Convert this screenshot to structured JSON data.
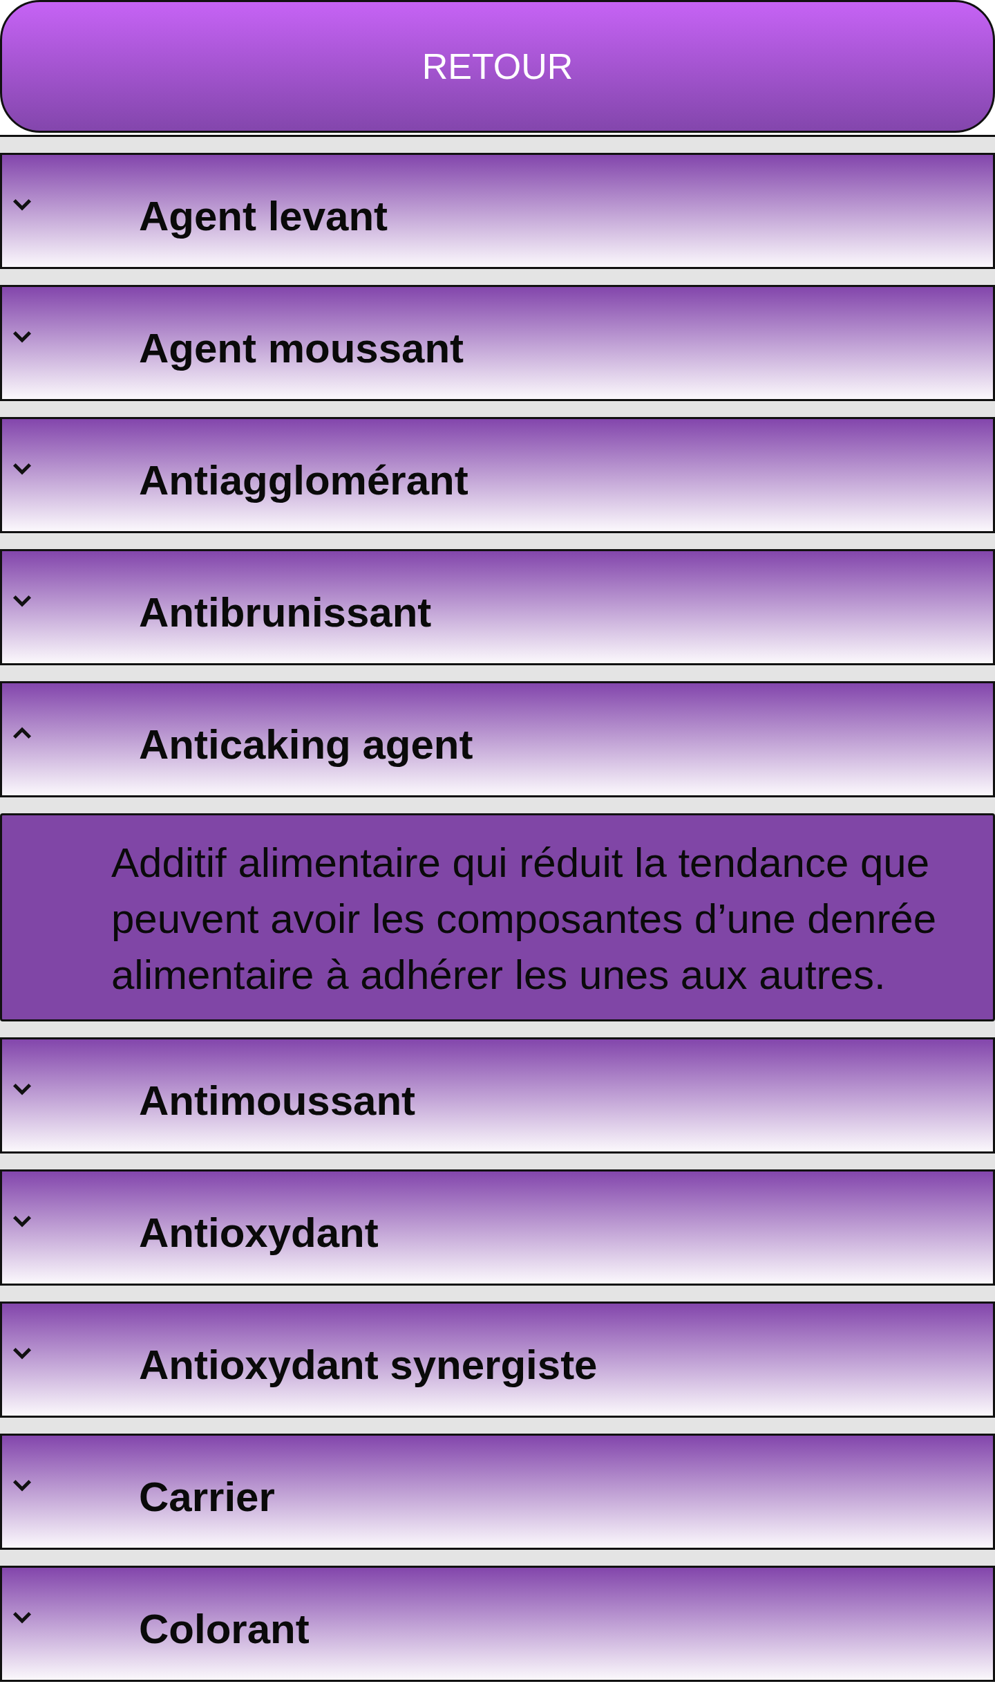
{
  "back_button": {
    "label": "RETOUR"
  },
  "items": [
    {
      "title": "Agent levant",
      "expanded": false
    },
    {
      "title": "Agent moussant",
      "expanded": false
    },
    {
      "title": "Antiagglomérant",
      "expanded": false
    },
    {
      "title": "Antibrunissant",
      "expanded": false
    },
    {
      "title": "Anticaking agent",
      "expanded": true,
      "description": "Additif alimentaire qui réduit la tendance que peuvent avoir les composantes d’une denrée alimentaire à adhérer les unes aux autres."
    },
    {
      "title": "Antimoussant",
      "expanded": false
    },
    {
      "title": "Antioxydant",
      "expanded": false
    },
    {
      "title": "Antioxydant synergiste",
      "expanded": false
    },
    {
      "title": "Carrier",
      "expanded": false
    },
    {
      "title": "Colorant",
      "expanded": false
    }
  ]
}
